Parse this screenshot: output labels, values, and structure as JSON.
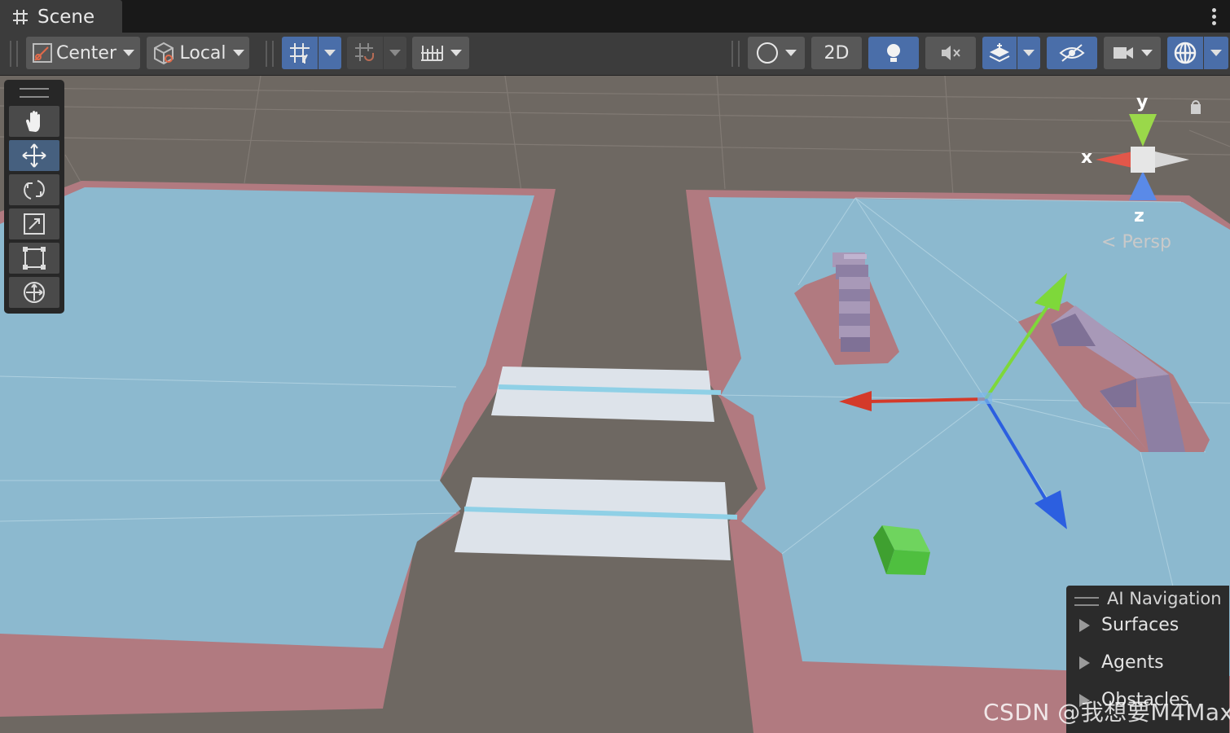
{
  "window": {
    "tab_title": "Scene"
  },
  "toolbar": {
    "pivot_mode": "Center",
    "pivot_rotation": "Local",
    "view_2d": "2D"
  },
  "tools": [
    "hand-tool",
    "move-tool",
    "rotate-tool",
    "scale-tool",
    "rect-tool",
    "transform-tool"
  ],
  "gizmo": {
    "x": "x",
    "y": "y",
    "z": "z",
    "projection": "Persp"
  },
  "ai_navigation": {
    "title": "AI Navigation",
    "items": [
      "Surfaces",
      "Agents",
      "Obstacles"
    ]
  },
  "watermark": "CSDN @我想要M4Max",
  "colors": {
    "navmesh": "#8cb9cf",
    "navmesh_border": "#b17a80",
    "ground": "#6e6862",
    "active_button": "#4a6ea9",
    "axis_x": "#d43a2a",
    "axis_y": "#7ed83a",
    "axis_z": "#2c5fe0",
    "selected_cube": "#4fbf3f"
  }
}
